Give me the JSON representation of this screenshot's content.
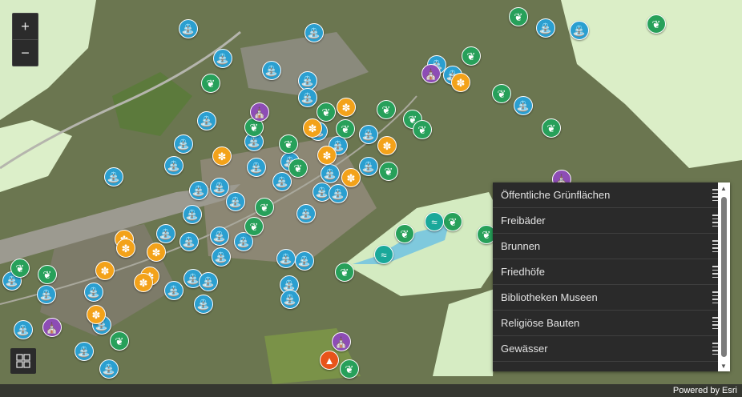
{
  "zoom": {
    "in_label": "+",
    "out_label": "−"
  },
  "layers": [
    {
      "label": "Öffentliche Grünflächen"
    },
    {
      "label": "Freibäder"
    },
    {
      "label": "Brunnen"
    },
    {
      "label": "Friedhöfe"
    },
    {
      "label": "Bibliotheken Museen"
    },
    {
      "label": "Religiöse Bauten"
    },
    {
      "label": "Gewässer"
    }
  ],
  "attribution": "Powered by Esri",
  "colors": {
    "fountain": "#2b9fd0",
    "park": "#27a05a",
    "museum": "#f3a21a",
    "church": "#8d4db5",
    "bath": "#1aa89a",
    "cemetery": "#e8541a"
  },
  "icons": {
    "fountain": "fountain-icon",
    "park": "leaf-icon",
    "museum": "palette-icon",
    "church": "church-icon",
    "bath": "swimming-icon",
    "cemetery": "cemetery-icon",
    "basemap": "basemap-gallery-icon"
  }
}
